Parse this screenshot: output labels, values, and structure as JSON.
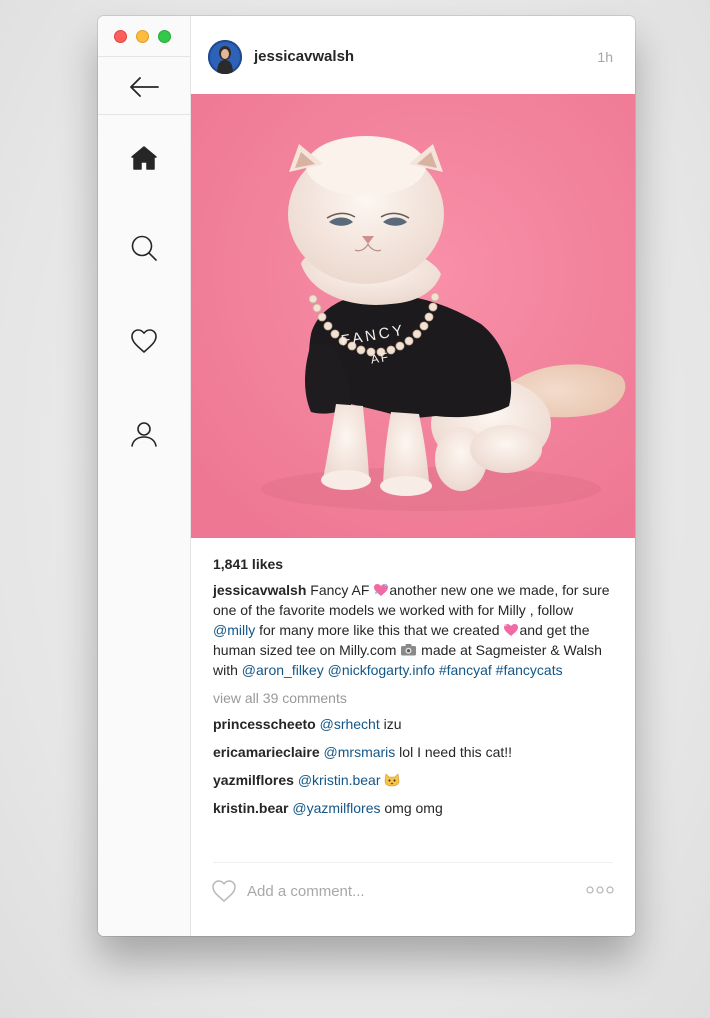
{
  "window": {
    "traffic_lights": [
      "#fc605c",
      "#fdbc40",
      "#34c84a"
    ]
  },
  "sidebar": {
    "items": [
      {
        "name": "back",
        "icon": "back-arrow-icon"
      },
      {
        "name": "home",
        "icon": "home-icon",
        "active": true
      },
      {
        "name": "search",
        "icon": "search-icon"
      },
      {
        "name": "activity",
        "icon": "heart-icon"
      },
      {
        "name": "profile",
        "icon": "profile-icon"
      }
    ]
  },
  "post": {
    "username": "jessicavwalsh",
    "time": "1h",
    "photo_icon": "cat-photo",
    "likes": "1,841 likes",
    "caption": {
      "author": "jessicavwalsh",
      "t1": " Fancy AF ",
      "t2": "another new one we made, for sure one of the favorite models we worked with for Milly , follow ",
      "tag_milly": "@milly",
      "t3": " for many more like this that we created ",
      "t4": "and get the human sized tee on Milly.com ",
      "t5": " made at Sagmeister & Walsh with ",
      "tag_aron": "@aron_filkey",
      "tag_nick": "@nickfogarty.info",
      "tag_fancyaf": "#fancyaf",
      "tag_fancycats": "#fancycats"
    },
    "view_all_comments": "view all 39 comments",
    "comments": [
      {
        "author": "princesscheeto",
        "mention": "@srhecht",
        "text": " izu"
      },
      {
        "author": "ericamarieclaire",
        "mention": "@mrsmaris",
        "text": " lol I need this cat!!"
      },
      {
        "author": "yazmilflores",
        "mention": "@kristin.bear",
        "text": " "
      },
      {
        "author": "kristin.bear",
        "mention": "@yazmilflores",
        "text": " omg omg"
      }
    ],
    "shirt_text_1": "FANCY",
    "shirt_text_2": "AF"
  },
  "footer": {
    "comment_placeholder": "Add a comment...",
    "like_icon": "heart-outline-icon",
    "more_icon": "more-options-icon"
  },
  "colors": {
    "link": "#125688",
    "photo_bg": "#f2839d",
    "muted": "#999999"
  }
}
